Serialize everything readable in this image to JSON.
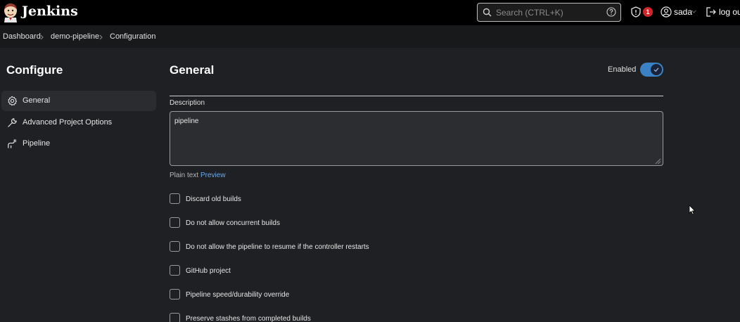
{
  "header": {
    "brand": "Jenkins",
    "search_placeholder": "Search (CTRL+K)",
    "security_badge": "1",
    "user": "sada",
    "logout": "log out"
  },
  "breadcrumb": [
    "Dashboard",
    "demo-pipeline",
    "Configuration"
  ],
  "sidebar": {
    "title": "Configure",
    "items": [
      {
        "label": "General",
        "icon": "gear-icon",
        "active": true
      },
      {
        "label": "Advanced Project Options",
        "icon": "wrench-icon",
        "active": false
      },
      {
        "label": "Pipeline",
        "icon": "pipeline-icon",
        "active": false
      }
    ]
  },
  "main": {
    "title": "General",
    "enabled_label": "Enabled",
    "enabled": true,
    "description_label": "Description",
    "description_value": "pipeline",
    "plain_text": "Plain text",
    "preview": "Preview",
    "options": [
      {
        "label": "Discard old builds",
        "checked": false
      },
      {
        "label": "Do not allow concurrent builds",
        "checked": false
      },
      {
        "label": "Do not allow the pipeline to resume if the controller restarts",
        "checked": false
      },
      {
        "label": "GitHub project",
        "checked": false
      },
      {
        "label": "Pipeline speed/durability override",
        "checked": false
      },
      {
        "label": "Preserve stashes from completed builds",
        "checked": false
      }
    ]
  },
  "colors": {
    "background": "#1f2023",
    "header": "#000000",
    "accent": "#3b82c4",
    "link": "#6ea9e8",
    "badge": "#d0262a"
  }
}
